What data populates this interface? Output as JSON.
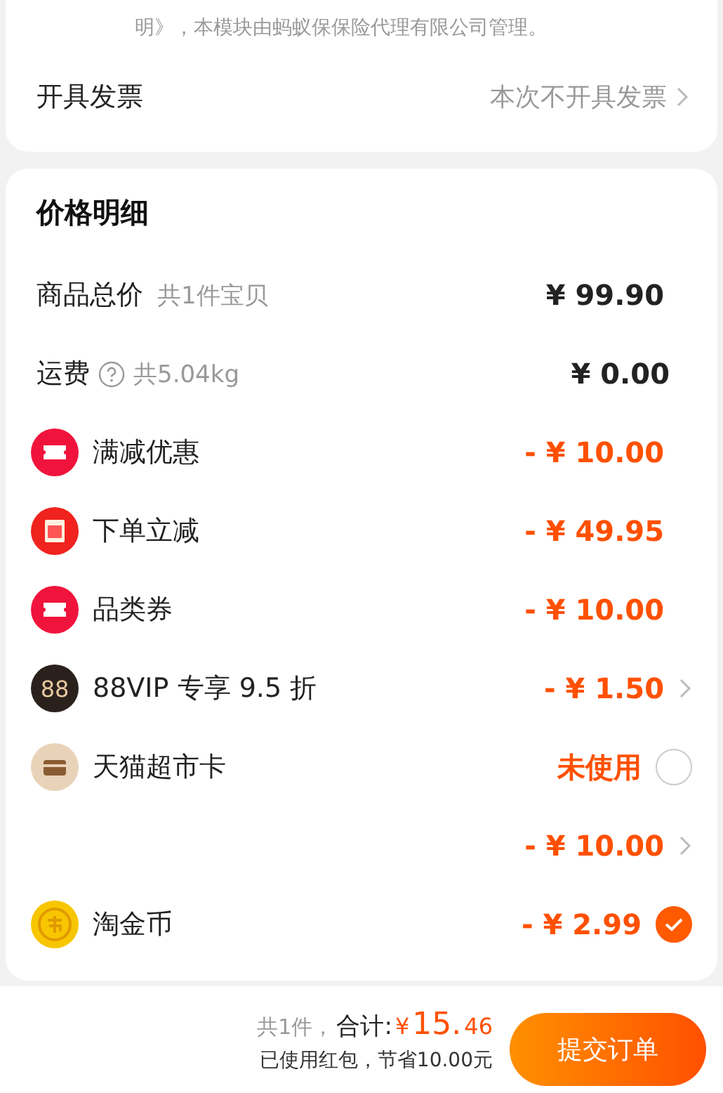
{
  "insurance_note": {
    "text": "明》，本模块由蚂蚁保保险代理有限公司管理。"
  },
  "invoice": {
    "label": "开具发票",
    "value": "本次不开具发票"
  },
  "price_detail": {
    "title": "价格明细",
    "rows": [
      {
        "kind": "plain",
        "label": "商品总价",
        "note": "共1件宝贝",
        "amount": "¥ 99.90",
        "help": false
      },
      {
        "kind": "plain",
        "label": "运费",
        "note": "共5.04kg",
        "amount": "¥ 0.00",
        "help": true
      },
      {
        "kind": "ticket",
        "label": "满减优惠",
        "amount": "- ¥ 10.00",
        "chevron": false
      },
      {
        "kind": "instant",
        "label": "下单立减",
        "amount": "- ¥ 49.95",
        "chevron": false
      },
      {
        "kind": "ticket",
        "label": "品类券",
        "amount": "- ¥ 10.00",
        "chevron": false
      },
      {
        "kind": "vip",
        "icon_text": "88",
        "label": "88VIP 专享 9.5 折",
        "amount": "- ¥ 1.50",
        "chevron": true
      },
      {
        "kind": "card",
        "label": "天猫超市卡",
        "amount": "未使用",
        "checked": false
      },
      {
        "kind": "blank",
        "amount": "- ¥ 10.00",
        "chevron": true
      },
      {
        "kind": "coin",
        "label": "淘金币",
        "amount": "- ¥ 2.99",
        "checked": true
      }
    ]
  },
  "footer": {
    "count": "共1件，",
    "total_label": "合计:",
    "currency": "¥",
    "total_int": "15.",
    "total_dec": "46",
    "savings": "已使用红包，节省10.00元",
    "submit": "提交订单"
  }
}
